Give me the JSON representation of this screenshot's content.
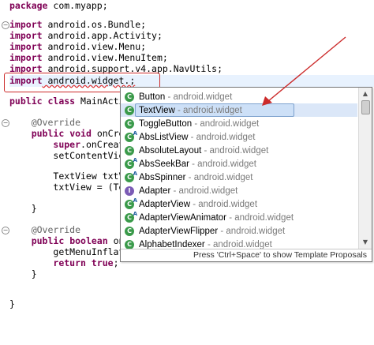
{
  "code": {
    "package_kw": "package",
    "package_name": " com.myapp;",
    "import_kw": "import",
    "imports": [
      " android.os.Bundle;",
      " android.app.Activity;",
      " android.view.Menu;",
      " android.view.MenuItem;",
      " android.support.v4.app.NavUtils;",
      " android.widget.;"
    ],
    "class_public": "public",
    "class_kw": "class",
    "class_name": " MainActiv",
    "override1": "@Override",
    "oncreate_public": "public",
    "oncreate_void": "void",
    "oncreate_name": " onCrea",
    "super_kw": "super",
    "super_rest": ".onCreate",
    "setcontent": "setContentView",
    "textview_decl": "TextView txtVi",
    "txtview_assign": "txtView = (Tex",
    "close_brace_1": "}",
    "override2": "@Override",
    "menu_public": "public",
    "menu_boolean": "boolean",
    "menu_name": " onC",
    "getmenu": "getMenuInflate",
    "return_kw": "return",
    "true_kw": "true",
    "semicolon": ";",
    "close_brace_2": "}",
    "close_brace_3": "}"
  },
  "popup": {
    "proposals": [
      {
        "name": "Button",
        "pkg": " - android.widget",
        "icon": "class-icon",
        "badge": ""
      },
      {
        "name": "TextView",
        "pkg": " - android.widget",
        "icon": "class-icon",
        "badge": ""
      },
      {
        "name": "ToggleButton",
        "pkg": " - android.widget",
        "icon": "class-icon",
        "badge": ""
      },
      {
        "name": "AbsListView",
        "pkg": " - android.widget",
        "icon": "class-icon",
        "badge": "A"
      },
      {
        "name": "AbsoluteLayout",
        "pkg": " - android.widget",
        "icon": "class-icon",
        "badge": ""
      },
      {
        "name": "AbsSeekBar",
        "pkg": " - android.widget",
        "icon": "class-icon",
        "badge": "A"
      },
      {
        "name": "AbsSpinner",
        "pkg": " - android.widget",
        "icon": "class-icon",
        "badge": "A"
      },
      {
        "name": "Adapter",
        "pkg": " - android.widget",
        "icon": "interface-icon",
        "badge": ""
      },
      {
        "name": "AdapterView",
        "pkg": " - android.widget",
        "icon": "class-icon",
        "badge": "A"
      },
      {
        "name": "AdapterViewAnimator",
        "pkg": " - android.widget",
        "icon": "class-icon",
        "badge": "A"
      },
      {
        "name": "AdapterViewFlipper",
        "pkg": " - android.widget",
        "icon": "class-icon",
        "badge": ""
      },
      {
        "name": "AlphabetIndexer",
        "pkg": " - android.widget",
        "icon": "class-icon",
        "badge": ""
      }
    ],
    "icon_letter_class": "C",
    "icon_letter_interface": "I",
    "footer": "Press 'Ctrl+Space' to show Template Proposals"
  },
  "colors": {
    "keyword": "#7f0055",
    "annotation": "#646464",
    "annotation_box": "#cc2b2b",
    "selection": "#cde0f7"
  }
}
